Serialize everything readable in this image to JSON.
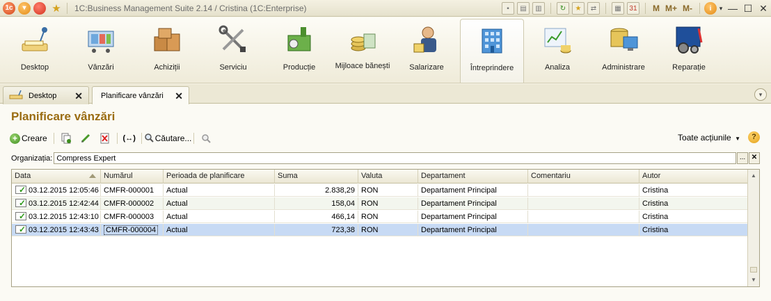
{
  "window": {
    "title": "1C:Business Management Suite 2.14 / Cristina  (1C:Enterprise)",
    "m_labels": [
      "M",
      "M+",
      "M-"
    ]
  },
  "sections": [
    {
      "label": "Desktop",
      "icon": "desktop-icon"
    },
    {
      "label": "Vânzări",
      "icon": "sales-cart-icon"
    },
    {
      "label": "Achiziții",
      "icon": "purchases-boxes-icon"
    },
    {
      "label": "Serviciu",
      "icon": "service-tools-icon"
    },
    {
      "label": "Producție",
      "icon": "production-icon"
    },
    {
      "label": "Mijloace bănești",
      "icon": "money-coins-icon"
    },
    {
      "label": "Salarizare",
      "icon": "payroll-person-icon"
    },
    {
      "label": "Întreprindere",
      "icon": "enterprise-building-icon",
      "active": true
    },
    {
      "label": "Analiza",
      "icon": "analysis-chart-icon"
    },
    {
      "label": "Administrare",
      "icon": "administration-icon"
    },
    {
      "label": "Reparație",
      "icon": "repair-gears-icon"
    }
  ],
  "tabs": [
    {
      "label": "Desktop",
      "active": false
    },
    {
      "label": "Planificare vânzări",
      "active": true
    }
  ],
  "form": {
    "title": "Planificare vânzări",
    "toolbar": {
      "create_label": "Creare",
      "search_label": "Căutare...",
      "all_actions_label": "Toate acțiunile"
    },
    "organization": {
      "label": "Organizația:",
      "value": "Compress Expert"
    }
  },
  "table": {
    "columns": [
      "Data",
      "Numărul",
      "Perioada de planificare",
      "Suma",
      "Valuta",
      "Departament",
      "Comentariu",
      "Autor"
    ],
    "rows": [
      {
        "data": "03.12.2015 12:05:46",
        "numarul": "CMFR-000001",
        "perioada": "Actual",
        "suma": "2.838,29",
        "valuta": "RON",
        "departament": "Departament Principal",
        "comentariu": "",
        "autor": "Cristina"
      },
      {
        "data": "03.12.2015 12:42:44",
        "numarul": "CMFR-000002",
        "perioada": "Actual",
        "suma": "158,04",
        "valuta": "RON",
        "departament": "Departament Principal",
        "comentariu": "",
        "autor": "Cristina"
      },
      {
        "data": "03.12.2015 12:43:10",
        "numarul": "CMFR-000003",
        "perioada": "Actual",
        "suma": "466,14",
        "valuta": "RON",
        "departament": "Departament Principal",
        "comentariu": "",
        "autor": "Cristina"
      },
      {
        "data": "03.12.2015 12:43:43",
        "numarul": "CMFR-000004",
        "perioada": "Actual",
        "suma": "723,38",
        "valuta": "RON",
        "departament": "Departament Principal",
        "comentariu": "",
        "autor": "Cristina",
        "selected": true
      }
    ]
  },
  "colors": {
    "title_accent": "#9a6c12",
    "selected_row": "#c7daf4",
    "alt_row": "#f3f6ee"
  }
}
